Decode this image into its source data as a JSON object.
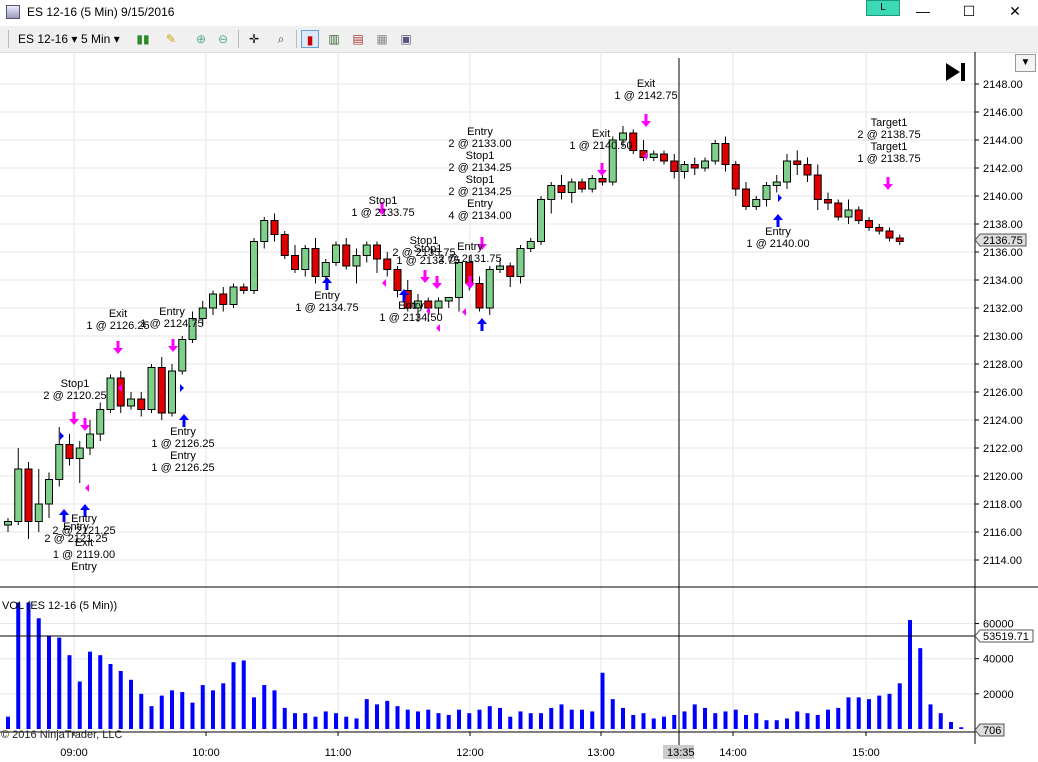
{
  "window": {
    "title": "ES 12-16 (5 Min)  9/15/2016",
    "link_label": "L",
    "minimize": "—",
    "maximize": "☐",
    "close": "✕"
  },
  "toolbar": {
    "instrument": "ES 12-16",
    "period": "5 Min"
  },
  "price_axis": {
    "labels": [
      "2148.00",
      "2146.00",
      "2144.00",
      "2142.00",
      "2140.00",
      "2138.00",
      "2136.00",
      "2134.00",
      "2132.00",
      "2130.00",
      "2128.00",
      "2126.00",
      "2124.00",
      "2122.00",
      "2120.00",
      "2118.00",
      "2116.00",
      "2114.00"
    ],
    "last_price": "2136.75"
  },
  "volume_panel": {
    "title": "VOL (ES 12-16 (5 Min))",
    "axis_labels": [
      "60000",
      "40000",
      "20000"
    ],
    "crosshair_value": "53519.71",
    "last_value": "706"
  },
  "time_axis": {
    "labels": [
      "09:00",
      "10:00",
      "11:00",
      "12:00",
      "13:00",
      "14:00",
      "15:00"
    ],
    "cursor_time": "13:35"
  },
  "copyright": "© 2016 NinjaTrader, LLC",
  "annotations": [
    {
      "lines": [
        "Stop1",
        "2 @ 2120.25"
      ]
    },
    {
      "lines": [
        "Exit",
        "1 @ 2126.25"
      ]
    },
    {
      "lines": [
        "Entry",
        "1 @ 2124.75"
      ]
    },
    {
      "lines": [
        "Entry",
        "1 @ 2126.25",
        "Entry",
        "1 @ 2126.25"
      ]
    },
    {
      "lines": [
        "Entry",
        "2 @ 2121.25"
      ]
    },
    {
      "lines": [
        "Entry",
        "2 @ 2121.25",
        "Exit",
        "1 @ 2119.00",
        "Entry"
      ]
    },
    {
      "lines": [
        "Stop1",
        "1 @ 2133.75"
      ]
    },
    {
      "lines": [
        "Entry",
        "1 @ 2134.75"
      ]
    },
    {
      "lines": [
        "Entry",
        "1 @ 2134.50"
      ]
    },
    {
      "lines": [
        "Stop1",
        "2 @ 2135.75"
      ]
    },
    {
      "lines": [
        "Stop1",
        "1 @ 2133.75"
      ]
    },
    {
      "lines": [
        "Entry",
        "2 @ 2131.75"
      ]
    },
    {
      "lines": [
        "Entry",
        "2 @ 2133.00",
        "Stop1",
        "2 @ 2134.25",
        "Stop1",
        "2 @ 2134.25",
        "Entry",
        "4 @ 2134.00"
      ]
    },
    {
      "lines": [
        "Exit",
        "1 @ 2140.50"
      ]
    },
    {
      "lines": [
        "Exit",
        "1 @ 2142.75"
      ]
    },
    {
      "lines": [
        "Entry",
        "1 @ 2140.00"
      ]
    },
    {
      "lines": [
        "Target1",
        "2 @ 2138.75",
        "Target1",
        "1 @ 2138.75"
      ]
    }
  ],
  "candles": [
    {
      "o": 2116.5,
      "h": 2117.0,
      "l": 2116.0,
      "c": 2116.75
    },
    {
      "o": 2116.75,
      "h": 2122.0,
      "l": 2116.5,
      "c": 2120.5
    },
    {
      "o": 2120.5,
      "h": 2121.0,
      "l": 2115.5,
      "c": 2116.75
    },
    {
      "o": 2116.75,
      "h": 2120.5,
      "l": 2116.0,
      "c": 2118.0
    },
    {
      "o": 2118.0,
      "h": 2120.25,
      "l": 2117.0,
      "c": 2119.75
    },
    {
      "o": 2119.75,
      "h": 2123.5,
      "l": 2119.25,
      "c": 2122.25
    },
    {
      "o": 2122.25,
      "h": 2123.0,
      "l": 2120.75,
      "c": 2121.25
    },
    {
      "o": 2121.25,
      "h": 2122.5,
      "l": 2119.5,
      "c": 2122.0
    },
    {
      "o": 2122.0,
      "h": 2124.0,
      "l": 2121.5,
      "c": 2123.0
    },
    {
      "o": 2123.0,
      "h": 2125.25,
      "l": 2122.5,
      "c": 2124.75
    },
    {
      "o": 2124.75,
      "h": 2127.25,
      "l": 2124.5,
      "c": 2127.0
    },
    {
      "o": 2127.0,
      "h": 2127.5,
      "l": 2124.5,
      "c": 2125.0
    },
    {
      "o": 2125.0,
      "h": 2126.0,
      "l": 2124.75,
      "c": 2125.5
    },
    {
      "o": 2125.5,
      "h": 2126.0,
      "l": 2124.25,
      "c": 2124.75
    },
    {
      "o": 2124.75,
      "h": 2128.0,
      "l": 2124.5,
      "c": 2127.75
    },
    {
      "o": 2127.75,
      "h": 2128.5,
      "l": 2124.0,
      "c": 2124.5
    },
    {
      "o": 2124.5,
      "h": 2128.0,
      "l": 2124.25,
      "c": 2127.5
    },
    {
      "o": 2127.5,
      "h": 2130.0,
      "l": 2127.25,
      "c": 2129.75
    },
    {
      "o": 2129.75,
      "h": 2131.75,
      "l": 2129.5,
      "c": 2131.25
    },
    {
      "o": 2131.25,
      "h": 2132.5,
      "l": 2130.75,
      "c": 2132.0
    },
    {
      "o": 2132.0,
      "h": 2133.25,
      "l": 2131.5,
      "c": 2133.0
    },
    {
      "o": 2133.0,
      "h": 2133.5,
      "l": 2131.75,
      "c": 2132.25
    },
    {
      "o": 2132.25,
      "h": 2133.75,
      "l": 2132.0,
      "c": 2133.5
    },
    {
      "o": 2133.5,
      "h": 2133.75,
      "l": 2133.0,
      "c": 2133.25
    },
    {
      "o": 2133.25,
      "h": 2137.0,
      "l": 2133.0,
      "c": 2136.75
    },
    {
      "o": 2136.75,
      "h": 2138.5,
      "l": 2136.25,
      "c": 2138.25
    },
    {
      "o": 2138.25,
      "h": 2138.75,
      "l": 2136.75,
      "c": 2137.25
    },
    {
      "o": 2137.25,
      "h": 2137.5,
      "l": 2135.5,
      "c": 2135.75
    },
    {
      "o": 2135.75,
      "h": 2136.5,
      "l": 2134.5,
      "c": 2134.75
    },
    {
      "o": 2134.75,
      "h": 2136.5,
      "l": 2134.25,
      "c": 2136.25
    },
    {
      "o": 2136.25,
      "h": 2137.0,
      "l": 2133.75,
      "c": 2134.25
    },
    {
      "o": 2134.25,
      "h": 2135.5,
      "l": 2134.0,
      "c": 2135.25
    },
    {
      "o": 2135.25,
      "h": 2136.75,
      "l": 2135.0,
      "c": 2136.5
    },
    {
      "o": 2136.5,
      "h": 2137.0,
      "l": 2134.75,
      "c": 2135.0
    },
    {
      "o": 2135.0,
      "h": 2136.25,
      "l": 2133.75,
      "c": 2135.75
    },
    {
      "o": 2135.75,
      "h": 2136.75,
      "l": 2135.25,
      "c": 2136.5
    },
    {
      "o": 2136.5,
      "h": 2136.75,
      "l": 2134.5,
      "c": 2135.5
    },
    {
      "o": 2135.5,
      "h": 2136.0,
      "l": 2134.25,
      "c": 2134.75
    },
    {
      "o": 2134.75,
      "h": 2135.0,
      "l": 2132.75,
      "c": 2133.25
    },
    {
      "o": 2133.25,
      "h": 2134.0,
      "l": 2131.75,
      "c": 2132.0
    },
    {
      "o": 2132.0,
      "h": 2133.0,
      "l": 2131.0,
      "c": 2132.5
    },
    {
      "o": 2132.5,
      "h": 2132.75,
      "l": 2131.0,
      "c": 2132.0
    },
    {
      "o": 2132.0,
      "h": 2132.75,
      "l": 2131.5,
      "c": 2132.5
    },
    {
      "o": 2132.5,
      "h": 2132.75,
      "l": 2132.0,
      "c": 2132.75
    },
    {
      "o": 2132.75,
      "h": 2135.5,
      "l": 2131.75,
      "c": 2135.25
    },
    {
      "o": 2135.25,
      "h": 2135.75,
      "l": 2133.25,
      "c": 2133.75
    },
    {
      "o": 2133.75,
      "h": 2134.25,
      "l": 2131.75,
      "c": 2132.0
    },
    {
      "o": 2132.0,
      "h": 2135.0,
      "l": 2131.5,
      "c": 2134.75
    },
    {
      "o": 2134.75,
      "h": 2135.5,
      "l": 2134.5,
      "c": 2135.0
    },
    {
      "o": 2135.0,
      "h": 2135.25,
      "l": 2133.5,
      "c": 2134.25
    },
    {
      "o": 2134.25,
      "h": 2136.5,
      "l": 2133.75,
      "c": 2136.25
    },
    {
      "o": 2136.25,
      "h": 2137.0,
      "l": 2136.0,
      "c": 2136.75
    },
    {
      "o": 2136.75,
      "h": 2140.0,
      "l": 2136.5,
      "c": 2139.75
    },
    {
      "o": 2139.75,
      "h": 2141.0,
      "l": 2138.75,
      "c": 2140.75
    },
    {
      "o": 2140.75,
      "h": 2141.5,
      "l": 2139.75,
      "c": 2140.25
    },
    {
      "o": 2140.25,
      "h": 2141.25,
      "l": 2139.5,
      "c": 2141.0
    },
    {
      "o": 2141.0,
      "h": 2141.25,
      "l": 2140.25,
      "c": 2140.5
    },
    {
      "o": 2140.5,
      "h": 2141.5,
      "l": 2140.25,
      "c": 2141.25
    },
    {
      "o": 2141.25,
      "h": 2141.5,
      "l": 2140.75,
      "c": 2141.0
    },
    {
      "o": 2141.0,
      "h": 2144.25,
      "l": 2140.75,
      "c": 2144.0
    },
    {
      "o": 2144.0,
      "h": 2145.0,
      "l": 2143.5,
      "c": 2144.5
    },
    {
      "o": 2144.5,
      "h": 2144.75,
      "l": 2143.0,
      "c": 2143.25
    },
    {
      "o": 2143.25,
      "h": 2144.0,
      "l": 2142.5,
      "c": 2142.75
    },
    {
      "o": 2142.75,
      "h": 2143.25,
      "l": 2142.5,
      "c": 2143.0
    },
    {
      "o": 2143.0,
      "h": 2143.25,
      "l": 2142.25,
      "c": 2142.5
    },
    {
      "o": 2142.5,
      "h": 2143.0,
      "l": 2141.25,
      "c": 2141.75
    },
    {
      "o": 2141.75,
      "h": 2142.5,
      "l": 2141.25,
      "c": 2142.25
    },
    {
      "o": 2142.25,
      "h": 2142.75,
      "l": 2141.5,
      "c": 2142.0
    },
    {
      "o": 2142.0,
      "h": 2142.75,
      "l": 2141.75,
      "c": 2142.5
    },
    {
      "o": 2142.5,
      "h": 2144.0,
      "l": 2142.25,
      "c": 2143.75
    },
    {
      "o": 2143.75,
      "h": 2144.25,
      "l": 2141.75,
      "c": 2142.25
    },
    {
      "o": 2142.25,
      "h": 2142.5,
      "l": 2140.0,
      "c": 2140.5
    },
    {
      "o": 2140.5,
      "h": 2141.0,
      "l": 2139.0,
      "c": 2139.25
    },
    {
      "o": 2139.25,
      "h": 2140.0,
      "l": 2139.0,
      "c": 2139.75
    },
    {
      "o": 2139.75,
      "h": 2141.0,
      "l": 2139.25,
      "c": 2140.75
    },
    {
      "o": 2140.75,
      "h": 2141.5,
      "l": 2140.25,
      "c": 2141.0
    },
    {
      "o": 2141.0,
      "h": 2143.0,
      "l": 2140.5,
      "c": 2142.5
    },
    {
      "o": 2142.5,
      "h": 2143.25,
      "l": 2141.5,
      "c": 2142.25
    },
    {
      "o": 2142.25,
      "h": 2142.75,
      "l": 2141.0,
      "c": 2141.5
    },
    {
      "o": 2141.5,
      "h": 2142.25,
      "l": 2139.0,
      "c": 2139.75
    },
    {
      "o": 2139.75,
      "h": 2140.25,
      "l": 2139.0,
      "c": 2139.5
    },
    {
      "o": 2139.5,
      "h": 2139.75,
      "l": 2138.25,
      "c": 2138.5
    },
    {
      "o": 2138.5,
      "h": 2139.75,
      "l": 2138.0,
      "c": 2139.0
    },
    {
      "o": 2139.0,
      "h": 2139.25,
      "l": 2138.0,
      "c": 2138.25
    },
    {
      "o": 2138.25,
      "h": 2138.5,
      "l": 2137.5,
      "c": 2137.75
    },
    {
      "o": 2137.75,
      "h": 2138.0,
      "l": 2137.25,
      "c": 2137.5
    },
    {
      "o": 2137.5,
      "h": 2137.75,
      "l": 2136.75,
      "c": 2137.0
    },
    {
      "o": 2137.0,
      "h": 2137.25,
      "l": 2136.5,
      "c": 2136.75
    }
  ],
  "volumes": [
    7000,
    72000,
    72000,
    63000,
    53000,
    52000,
    42000,
    27000,
    44000,
    42000,
    37000,
    33000,
    28000,
    20000,
    13000,
    19000,
    22000,
    21000,
    15000,
    25000,
    22000,
    26000,
    38000,
    39000,
    18000,
    25000,
    22000,
    12000,
    9000,
    9000,
    7000,
    10000,
    9000,
    7000,
    6000,
    17000,
    14000,
    16000,
    13000,
    11000,
    10000,
    11000,
    9000,
    8000,
    11000,
    9000,
    11000,
    13000,
    12000,
    7000,
    10000,
    9000,
    9000,
    12000,
    14000,
    11000,
    11000,
    10000,
    32000,
    17000,
    12000,
    8000,
    9000,
    6000,
    7000,
    8000,
    10000,
    14000,
    12000,
    9000,
    10000,
    11000,
    8000,
    9000,
    5000,
    5000,
    6000,
    10000,
    9000,
    8000,
    11000,
    12000,
    18000,
    18000,
    17000,
    19000,
    20000,
    26000,
    62000,
    46000,
    14000,
    9000,
    4000,
    1000
  ]
}
